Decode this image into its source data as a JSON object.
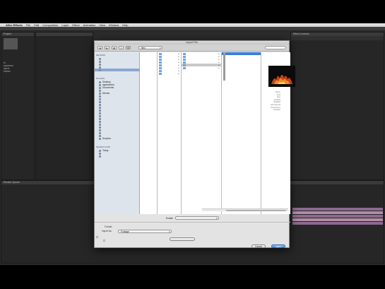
{
  "menubar": {
    "apple": "",
    "items": [
      "After Effects",
      "File",
      "Edit",
      "Composition",
      "Layer",
      "Effect",
      "Animation",
      "View",
      "Window",
      "Help"
    ],
    "right": [
      "",
      "",
      ""
    ]
  },
  "window_title": "",
  "left_panel": {
    "tab": "Project",
    "rows": [
      "",
      "bt",
      "sequence",
      "layers",
      "frames",
      "",
      "",
      ""
    ]
  },
  "right_panel": {
    "tab": "Effect Controls",
    "rows": [
      "",
      "",
      "",
      "",
      "",
      ""
    ]
  },
  "timeline": {
    "tabs": [
      "Render Queue",
      "",
      ""
    ],
    "time": "",
    "layers": [
      "",
      "",
      "",
      "",
      "",
      "",
      "",
      ""
    ]
  },
  "dialog": {
    "title": "Import File",
    "path": "files",
    "search_placeholder": "",
    "sidebar": {
      "devices_head": "DEVICES",
      "devices": [
        "",
        "",
        "",
        "",
        ""
      ],
      "places_head": "PLACES",
      "places": [
        "Desktop",
        "applications",
        "Documents",
        "",
        "Movies",
        "",
        "",
        "",
        "",
        "",
        "",
        "",
        "",
        "",
        "",
        "",
        "",
        "",
        "",
        "",
        "Dropbox"
      ],
      "search_head": "SEARCH FOR",
      "search": [
        "Today",
        "",
        ""
      ]
    },
    "col1": [
      "",
      "",
      "",
      "",
      "",
      "",
      "",
      "",
      "",
      "",
      "",
      "",
      "",
      "",
      "",
      "",
      "",
      "",
      "",
      "",
      "",
      "",
      "",
      "",
      "",
      ""
    ],
    "col2": [
      "",
      "",
      "",
      "",
      "",
      "",
      "",
      ""
    ],
    "col3": [
      "",
      "",
      "",
      "",
      "",
      "",
      "",
      "",
      "",
      "",
      ""
    ],
    "col4": [
      "",
      "",
      "",
      "",
      "",
      "",
      "",
      "",
      "",
      ""
    ],
    "meta": [
      {
        "k": "Name",
        "v": ""
      },
      {
        "k": "Kind",
        "v": ""
      },
      {
        "k": "Size",
        "v": ""
      },
      {
        "k": "Created",
        "v": ""
      },
      {
        "k": "Modified",
        "v": ""
      },
      {
        "k": "Last opened",
        "v": ""
      },
      {
        "k": "Dimensions",
        "v": ""
      },
      {
        "k": "Duration",
        "v": ""
      }
    ],
    "enable_label": "Enable",
    "enable_value": "",
    "format_label": "Format:",
    "format_value": "",
    "import_as_label": "Import As:",
    "import_as_value": "Footage",
    "sequence_label": "",
    "force_label": "",
    "import_folder_btn": "",
    "new_folder_btn": "",
    "cancel_btn": "Cancel",
    "open_btn": "Open"
  },
  "colors": {
    "accent": "#3d7fd8",
    "stage": "#2b2b2b",
    "dialog": "#e3e3e3",
    "timeline_bar_purple": "#8b6b8f",
    "timeline_bar_pink": "#b58aa5",
    "layer_label_red": "#cc3333"
  },
  "bottom_caption": ""
}
